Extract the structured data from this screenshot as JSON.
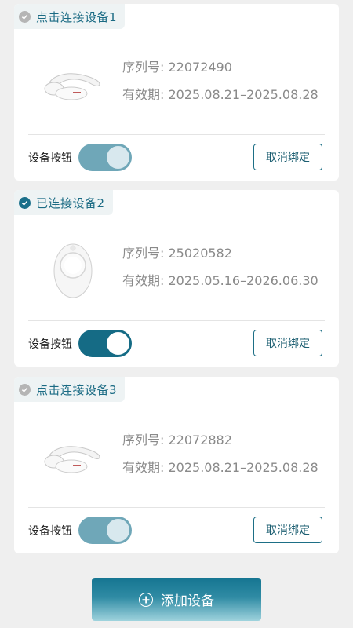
{
  "devices": [
    {
      "status_label": "点击连接设备1",
      "status": "unconnected",
      "product_icon": "neck-massager-icon",
      "serial": "序列号: 22072490",
      "validity": "有效期: 2025.08.21–2025.08.28",
      "switch_label": "设备按钮",
      "switch_on": false,
      "unbind_label": "取消绑定"
    },
    {
      "status_label": "已连接设备2",
      "status": "connected",
      "product_icon": "egg-massager-icon",
      "serial": "序列号: 25020582",
      "validity": "有效期: 2025.05.16–2026.06.30",
      "switch_label": "设备按钮",
      "switch_on": true,
      "unbind_label": "取消绑定"
    },
    {
      "status_label": "点击连接设备3",
      "status": "unconnected",
      "product_icon": "neck-massager-icon",
      "serial": "序列号: 22072882",
      "validity": "有效期: 2025.08.21–2025.08.28",
      "switch_label": "设备按钮",
      "switch_on": false,
      "unbind_label": "取消绑定"
    }
  ],
  "add_button": {
    "label": "添加设备",
    "icon": "plus-circle-icon"
  },
  "colors": {
    "accent": "#1a6f8a",
    "toggle_off": "#6fa7b8",
    "background": "#efefef"
  }
}
